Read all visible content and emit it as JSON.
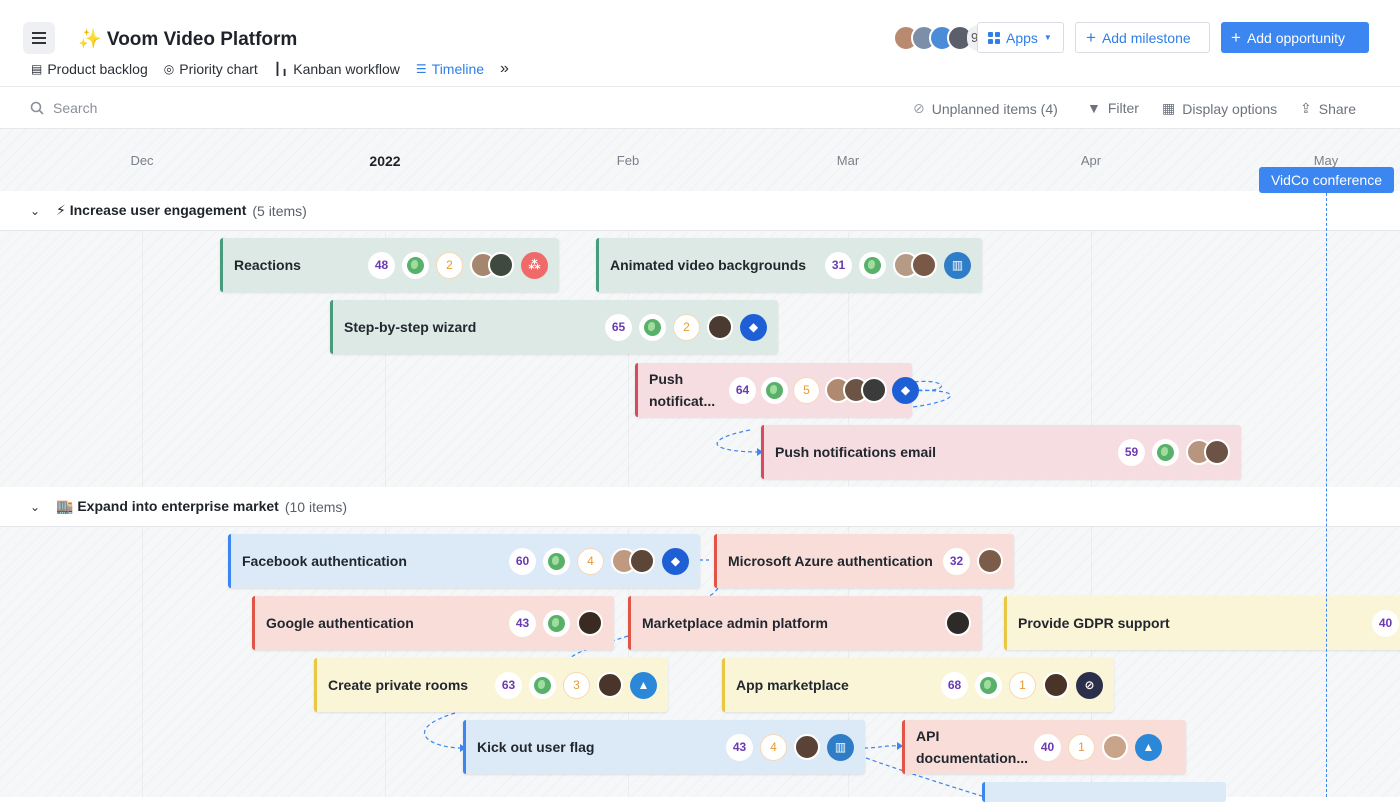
{
  "header": {
    "title": "✨ Voom Video Platform",
    "avatars_more": "9+",
    "apps_label": "Apps",
    "add_milestone_label": "Add milestone",
    "add_opportunity_label": "Add opportunity"
  },
  "nav": {
    "tabs": [
      {
        "label": "Product backlog"
      },
      {
        "label": "Priority chart"
      },
      {
        "label": "Kanban workflow"
      },
      {
        "label": "Timeline"
      }
    ]
  },
  "toolbar": {
    "search_placeholder": "Search",
    "unplanned_label": "Unplanned items (4)",
    "filter_label": "Filter",
    "display_label": "Display options",
    "share_label": "Share"
  },
  "months": {
    "dec": "Dec",
    "year": "2022",
    "feb": "Feb",
    "mar": "Mar",
    "apr": "Apr",
    "may": "May"
  },
  "milestone": {
    "label": "VidCo conference"
  },
  "groups": [
    {
      "title": "⚡ Increase user engagement",
      "count": "(5 items)"
    },
    {
      "title": "🏬 Expand into enterprise market",
      "count": "(10 items)"
    }
  ],
  "cards": {
    "reactions": {
      "title": "Reactions",
      "score": "48",
      "num": "2"
    },
    "animated": {
      "title": "Animated video backgrounds",
      "score": "31"
    },
    "wizard": {
      "title": "Step-by-step wizard",
      "score": "65",
      "num": "2"
    },
    "push": {
      "title": "Push notificat...",
      "score": "64",
      "num": "5"
    },
    "push_email": {
      "title": "Push notifications email",
      "score": "59"
    },
    "facebook": {
      "title": "Facebook authentication",
      "score": "60",
      "num": "4"
    },
    "azure": {
      "title": "Microsoft Azure authentication",
      "score": "32"
    },
    "google": {
      "title": "Google authentication",
      "score": "43"
    },
    "marketplace_admin": {
      "title": "Marketplace admin platform"
    },
    "gdpr": {
      "title": "Provide GDPR support",
      "score": "40"
    },
    "private_rooms": {
      "title": "Create private rooms",
      "score": "63",
      "num": "3"
    },
    "app_marketplace": {
      "title": "App marketplace",
      "score": "68",
      "num": "1"
    },
    "kick_out": {
      "title": "Kick out user flag",
      "score": "43",
      "num": "4"
    },
    "api_docs": {
      "title": "API documentation...",
      "score": "40",
      "num": "1"
    }
  },
  "colors": {
    "accent": "#3b86f0",
    "score_text": "#6a3ab0",
    "green_card": "#dde9e4",
    "pink_card": "#f6dde2",
    "blue_card": "#dce9f6",
    "red_card": "#f8ddd9",
    "yellow_card": "#fbf5d8"
  },
  "icons": [
    "menu-icon",
    "grid-icon",
    "plus-icon",
    "search-icon",
    "eye-off-icon",
    "filter-icon",
    "table-icon",
    "share-icon",
    "chevron-down-icon",
    "globe-icon",
    "jira-icon",
    "trello-icon",
    "asana-icon",
    "azure-icon"
  ]
}
